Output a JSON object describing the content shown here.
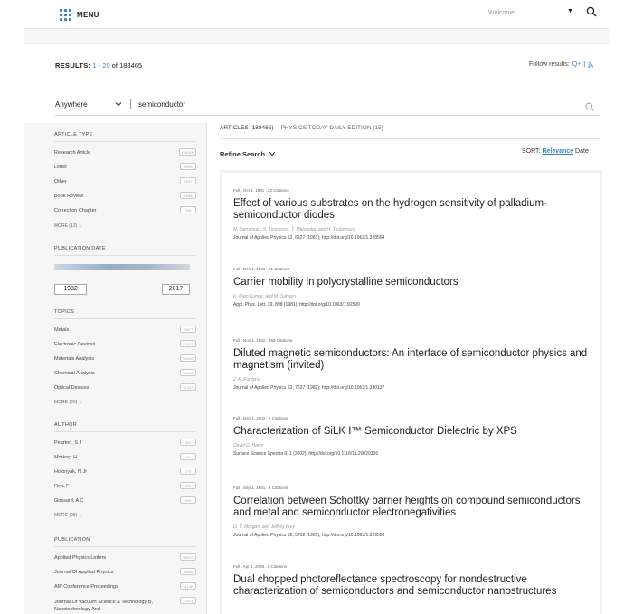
{
  "header": {
    "menu_label": "MENU",
    "welcome": "Welcome,",
    "caret": "▼"
  },
  "results": {
    "label": "RESULTS:",
    "range": "1 - 20",
    "of": "of",
    "total": "188465"
  },
  "follow": {
    "label": "Follow results:",
    "rss": "Q+",
    "sep": "|"
  },
  "search": {
    "scope": "Anywhere",
    "query": "semiconductor"
  },
  "sidebar": {
    "article_type": {
      "heading": "ARTICLE TYPE",
      "items": [
        {
          "label": "Research Article",
          "count": "176026"
        },
        {
          "label": "Letter",
          "count": "5608"
        },
        {
          "label": "Other",
          "count": "2847"
        },
        {
          "label": "Book Review",
          "count": "1038"
        },
        {
          "label": "Correction Chapter",
          "count": "766"
        }
      ],
      "more": "MORE (12)"
    },
    "publication_date": {
      "heading": "PUBLICATION DATE",
      "from": "1932",
      "to": "2017"
    },
    "topics": {
      "heading": "TOPICS",
      "items": [
        {
          "label": "Metals",
          "count": "70677"
        },
        {
          "label": "Electronic Devices",
          "count": "62437"
        },
        {
          "label": "Materials Analysis",
          "count": "53103"
        },
        {
          "label": "Chemical Analysis",
          "count": "46163"
        },
        {
          "label": "Optical Devices",
          "count": "41222"
        }
      ],
      "more": "MORE (95)"
    },
    "author": {
      "heading": "AUTHOR",
      "items": [
        {
          "label": "Pearton, S J",
          "count": "363"
        },
        {
          "label": "Morkoç, H",
          "count": "291"
        },
        {
          "label": "Holonyak, N Jr",
          "count": "275"
        },
        {
          "label": "Ren, F",
          "count": "232"
        },
        {
          "label": "Gossard, A C",
          "count": "209"
        }
      ],
      "more": "MORE (95)"
    },
    "publication": {
      "heading": "PUBLICATION",
      "items": [
        {
          "label": "Applied Physics Letters",
          "count": "56932"
        },
        {
          "label": "Journal Of Applied Physics",
          "count": "36880"
        },
        {
          "label": "AIP Conference Proceedings",
          "count": "11138"
        },
        {
          "label": "Journal Of Vacuum Science & Technology B, Nanotechnology And",
          "count": "11021"
        }
      ]
    }
  },
  "tabs": [
    {
      "label": "ARTICLES (188465)"
    },
    {
      "label": "PHYSICS TODAY DAILY EDITION (15)"
    }
  ],
  "refine": "Refine Search",
  "sort": {
    "label": "SORT:",
    "relevance": "Relevance",
    "date": "Date"
  },
  "articles": [
    {
      "meta": "Full . Oct 1, 1981 . 22 Citations",
      "title": "Effect of various substrates on the hydrogen sensitivity of palladium-semiconductor diodes",
      "authors": "N. Yamamoto, S. Tonomura, T. Matsuoka, and H. Tsubomura",
      "journal": "Journal of Applied Physics 52, 6227 (1981); http://doi.org/10.1063/1.328564"
    },
    {
      "meta": "Full . Dec 1, 1981 . 21 Citations",
      "title": "Carrier mobility in polycrystalline semiconductors",
      "authors": "K. Ram Kumar, and M. Satyam",
      "journal": "Appl. Phys. Lett. 39, 898 (1981); http://doi.org/10.1063/1.92599"
    },
    {
      "meta": "Full . Nov 1, 1982 . 369 Citations",
      "title": "Diluted magnetic semiconductors: An interface of semiconductor physics and magnetism (invited)",
      "authors": "J. K. Furdyna",
      "journal": "Journal of Applied Physics 53, 7637 (1982); http://doi.org/10.1063/1.330137"
    },
    {
      "meta": "Full . Dec 1, 2002 . 2 Citations",
      "title": "Characterization of SiLK I™ Semiconductor Dielectric by XPS",
      "authors": "David D. Hawn",
      "journal": "Surface Science Spectra 9, 1 (2002); http://doi.org/10.1116/11.20020306"
    },
    {
      "meta": "Full . Sep 1, 1981 . 4 Citations",
      "title": "Correlation between Schottky barrier heights on compound semiconductors and metal and semiconductor electronegativities",
      "authors": "D. V. Morgan, and Jeffrey Frey",
      "journal": "Journal of Applied Physics 52, 5702 (1981); http://doi.org/10.1063/1.329508"
    },
    {
      "meta": "Full . Apr 1, 2008 . 6 Citations",
      "title": "Dual chopped photoreflectance spectroscopy for nondestructive characterization of semiconductors and semiconductor nanostructures",
      "authors": "",
      "journal": ""
    }
  ]
}
